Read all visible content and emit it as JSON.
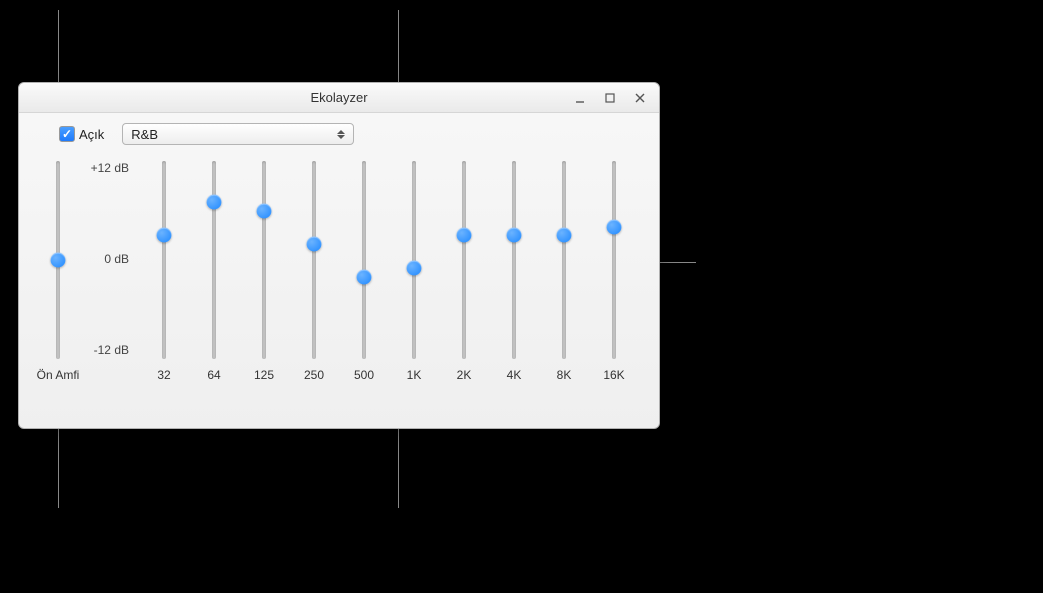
{
  "window": {
    "title": "Ekolayzer"
  },
  "controls": {
    "enable_checkbox": {
      "label": "Açık",
      "checked": true
    },
    "preset_dropdown": {
      "selected": "R&B"
    }
  },
  "scale": {
    "max": "+12 dB",
    "mid": "0 dB",
    "min": "-12 dB"
  },
  "preamp": {
    "label": "Ön Amfi",
    "value_db": 0
  },
  "bands": [
    {
      "freq": "32",
      "value_db": 3
    },
    {
      "freq": "64",
      "value_db": 7
    },
    {
      "freq": "125",
      "value_db": 6
    },
    {
      "freq": "250",
      "value_db": 2
    },
    {
      "freq": "500",
      "value_db": -2
    },
    {
      "freq": "1K",
      "value_db": -1
    },
    {
      "freq": "2K",
      "value_db": 3
    },
    {
      "freq": "4K",
      "value_db": 3
    },
    {
      "freq": "8K",
      "value_db": 3
    },
    {
      "freq": "16K",
      "value_db": 4
    }
  ],
  "colors": {
    "accent": "#1e88ff",
    "track": "#c4c4c4"
  },
  "icons": {
    "minimize": "minimize-icon",
    "maximize": "maximize-icon",
    "close": "close-icon"
  }
}
